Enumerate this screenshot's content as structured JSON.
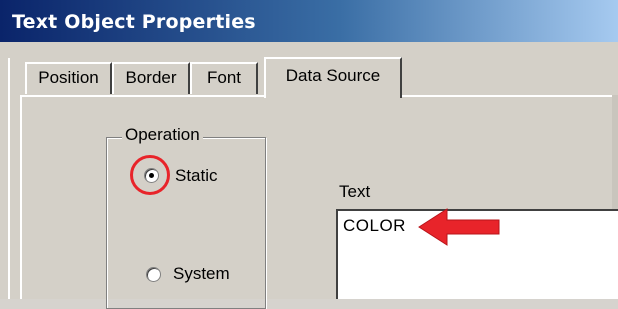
{
  "window": {
    "title": "Text Object Properties"
  },
  "tabs": [
    {
      "label": "Position",
      "active": false
    },
    {
      "label": "Border",
      "active": false
    },
    {
      "label": "Font",
      "active": false
    },
    {
      "label": "Data Source",
      "active": true
    }
  ],
  "operation": {
    "group_label": "Operation",
    "options": [
      {
        "label": "Static",
        "selected": true
      },
      {
        "label": "System",
        "selected": false
      }
    ]
  },
  "text_field": {
    "label": "Text",
    "value": "COLOR"
  },
  "annotations": {
    "highlight_color": "#e8242a",
    "arrow_color": "#e8242a",
    "arrow_icon": "arrow-left-icon",
    "ring_icon": "highlight-circle-icon"
  }
}
